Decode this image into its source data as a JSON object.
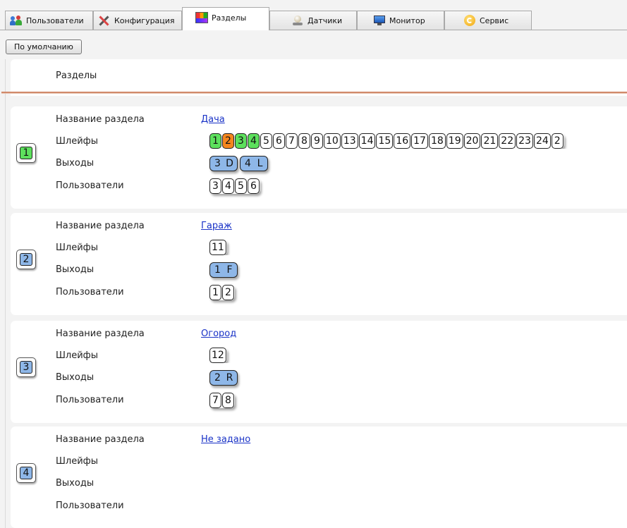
{
  "tabs": [
    {
      "label": "Пользователи",
      "icon": "users-icon"
    },
    {
      "label": "Конфигурация",
      "icon": "tools-icon"
    },
    {
      "label": "Разделы",
      "icon": "sections-icon",
      "active": true
    },
    {
      "label": "Датчики",
      "icon": "sensor-icon"
    },
    {
      "label": "Монитор",
      "icon": "monitor-icon"
    },
    {
      "label": "Сервис",
      "icon": "service-icon"
    }
  ],
  "toolbar": {
    "default_button": "По умолчанию"
  },
  "header": {
    "title": "Разделы"
  },
  "labels": {
    "name": "Название раздела",
    "loops": "Шлейфы",
    "outputs": "Выходы",
    "users": "Пользователи"
  },
  "colors": {
    "active_loop": "#5de05d",
    "alarm_loop": "#f5861e",
    "output": "#8eb7e8",
    "link": "#1a33c7"
  },
  "sections": [
    {
      "number": "1",
      "badge_color": "#5de05d",
      "name": "Дача",
      "loops": [
        {
          "n": "1",
          "state": "green"
        },
        {
          "n": "2",
          "state": "orange"
        },
        {
          "n": "3",
          "state": "green"
        },
        {
          "n": "4",
          "state": "green"
        },
        {
          "n": "5"
        },
        {
          "n": "6"
        },
        {
          "n": "7"
        },
        {
          "n": "8"
        },
        {
          "n": "9"
        },
        {
          "n": "10"
        },
        {
          "n": "13"
        },
        {
          "n": "14"
        },
        {
          "n": "15"
        },
        {
          "n": "16"
        },
        {
          "n": "17"
        },
        {
          "n": "18"
        },
        {
          "n": "19"
        },
        {
          "n": "20"
        },
        {
          "n": "21"
        },
        {
          "n": "22"
        },
        {
          "n": "23"
        },
        {
          "n": "24"
        },
        {
          "n": "2"
        }
      ],
      "outputs": [
        [
          "3",
          "D"
        ],
        [
          "4",
          "L"
        ]
      ],
      "users": [
        "3",
        "4",
        "5",
        "6"
      ]
    },
    {
      "number": "2",
      "badge_color": "#8eb7e8",
      "name": "Гараж",
      "loops": [
        {
          "n": "11"
        }
      ],
      "outputs": [
        [
          "1",
          "F"
        ]
      ],
      "users": [
        "1",
        "2"
      ]
    },
    {
      "number": "3",
      "badge_color": "#8eb7e8",
      "name": "Огород",
      "loops": [
        {
          "n": "12"
        }
      ],
      "outputs": [
        [
          "2",
          "R"
        ]
      ],
      "users": [
        "7",
        "8"
      ]
    },
    {
      "number": "4",
      "badge_color": "#8eb7e8",
      "name": "Не задано",
      "loops": [],
      "outputs": [],
      "users": []
    }
  ]
}
